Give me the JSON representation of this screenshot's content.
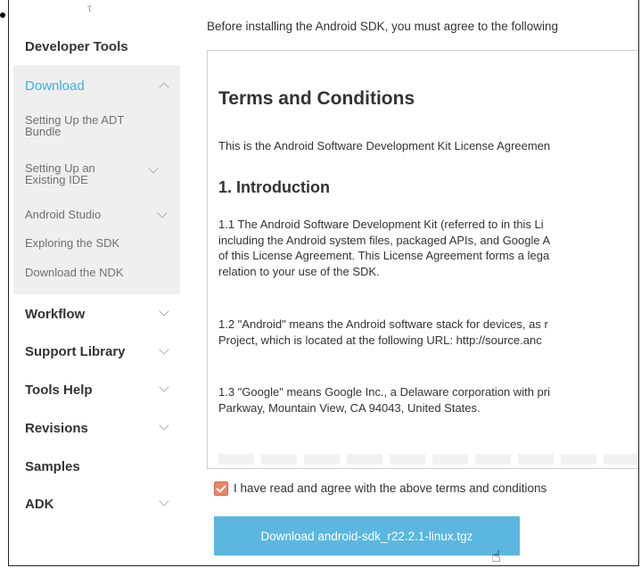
{
  "sidebar": {
    "top_mark": "τ",
    "developer_tools": "Developer Tools",
    "download": {
      "title": "Download",
      "items": [
        "Setting Up the ADT Bundle",
        "Setting Up an Existing IDE",
        "Android Studio",
        "Exploring the SDK",
        "Download the NDK"
      ]
    },
    "sections": [
      "Workflow",
      "Support Library",
      "Tools Help",
      "Revisions",
      "Samples",
      "ADK"
    ]
  },
  "main": {
    "intro": "Before installing the Android SDK, you must agree to the following",
    "terms": {
      "title": "Terms and Conditions",
      "subtitle": "This is the Android Software Development Kit License Agreemen",
      "section_heading": "1. Introduction",
      "p1": [
        "1.1 The Android Software Development Kit (referred to in this Li",
        "including the Android system files, packaged APIs, and Google A",
        "of this License Agreement. This License Agreement forms a lega",
        "relation to your use of the SDK."
      ],
      "p2": [
        "1.2 \"Android\" means the Android software stack for devices, as r",
        "Project, which is located at the following URL: http://source.anc"
      ],
      "p3": [
        "1.3 \"Google\" means Google Inc., a Delaware corporation with pri",
        "Parkway, Mountain View, CA 94043, United States."
      ]
    },
    "agree_label": "I have read and agree with the above terms and conditions",
    "agree_checked": true,
    "download_button": "Download android-sdk_r22.2.1-linux.tgz"
  },
  "colors": {
    "accent_blue": "#33b5e5",
    "button_blue": "#5bb7df",
    "checkbox_orange": "#e8866a"
  }
}
